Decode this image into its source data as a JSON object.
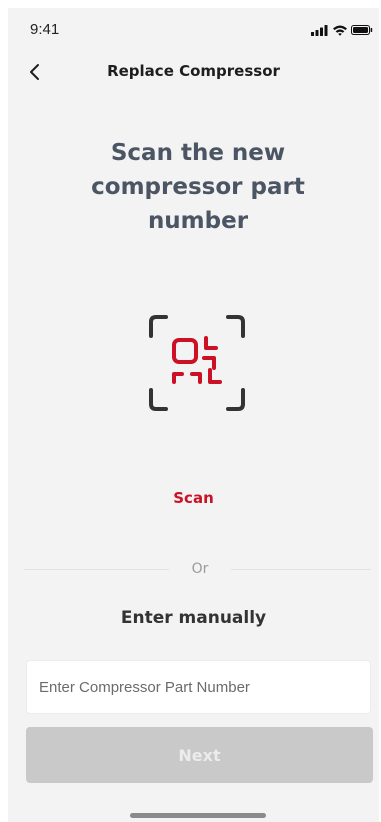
{
  "status_bar": {
    "time": "9:41",
    "icons": [
      "signal-icon",
      "wifi-icon",
      "battery-icon"
    ]
  },
  "nav": {
    "back_icon": "chevron-left-icon",
    "title": "Replace Compressor"
  },
  "main": {
    "headline": "Scan the new compressor part number",
    "scan_icon": "qr-scan-icon",
    "scan_label": "Scan",
    "divider_text": "Or",
    "manual_heading": "Enter manually",
    "input": {
      "placeholder": "Enter Compressor Part Number",
      "value": ""
    },
    "next_label": "Next"
  },
  "colors": {
    "accent": "#cc1126",
    "headline": "#4b5563",
    "background": "#f3f3f3",
    "button_disabled": "#c9c9c9"
  }
}
